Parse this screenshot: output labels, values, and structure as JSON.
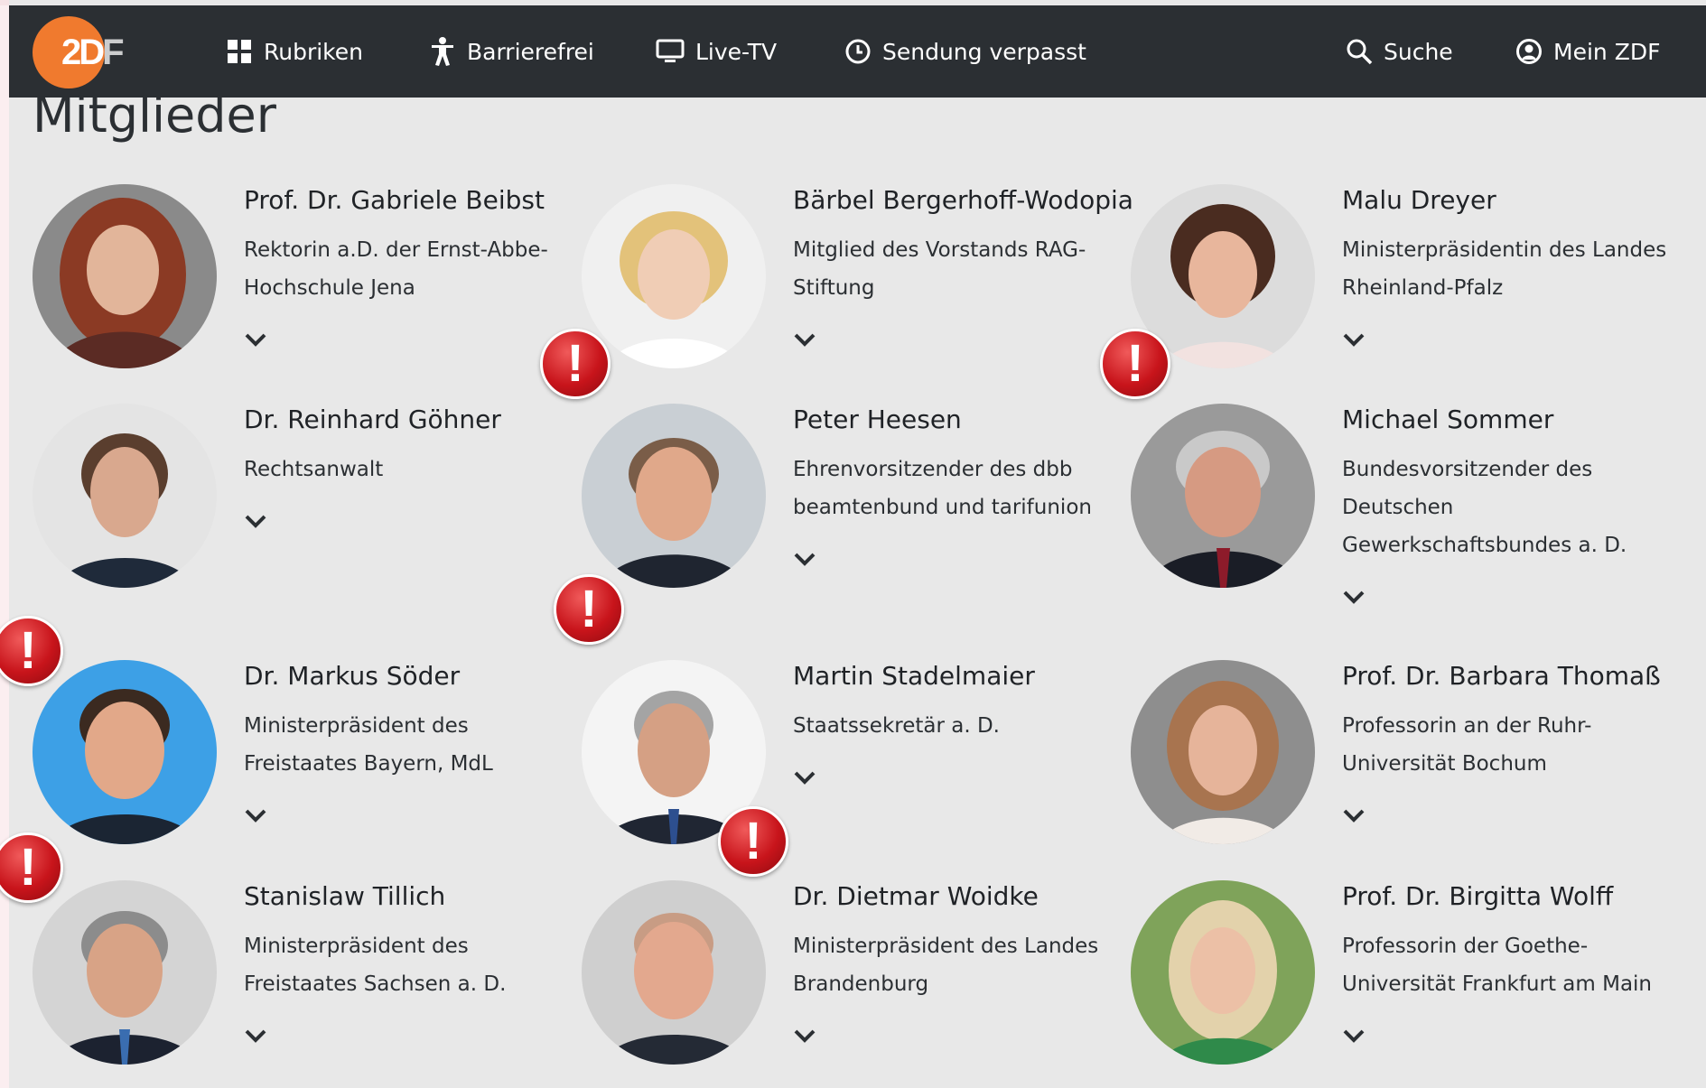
{
  "nav": {
    "logo_main": "2D",
    "logo_accent": "F",
    "items": [
      {
        "label": "Rubriken",
        "icon": "grid-icon"
      },
      {
        "label": "Barrierefrei",
        "icon": "accessibility-icon"
      },
      {
        "label": "Live-TV",
        "icon": "tv-icon"
      },
      {
        "label": "Sendung verpasst",
        "icon": "clock-icon"
      },
      {
        "label": "Suche",
        "icon": "search-icon"
      },
      {
        "label": "Mein ZDF",
        "icon": "user-icon"
      }
    ]
  },
  "section": {
    "title": "Mitglieder"
  },
  "members": [
    {
      "name": "Prof. Dr. Gabriele Beibst",
      "role": "Rektorin a.D. der Ernst-Abbe-Hochschule Jena"
    },
    {
      "name": "Bärbel Bergerhoff-Wodopia",
      "role": "Mitglied des Vorstands RAG-Stiftung"
    },
    {
      "name": "Malu Dreyer",
      "role": "Ministerpräsidentin des Landes Rheinland-Pfalz"
    },
    {
      "name": "Dr. Reinhard Göhner",
      "role": "Rechtsanwalt"
    },
    {
      "name": "Peter Heesen",
      "role": "Ehrenvorsitzender des dbb beamtenbund und tarifunion"
    },
    {
      "name": "Michael Sommer",
      "role": "Bundesvorsitzender des Deutschen Gewerkschaftsbundes a. D."
    },
    {
      "name": "Dr. Markus Söder",
      "role": "Ministerpräsident des Freistaates Bayern, MdL"
    },
    {
      "name": "Martin Stadelmaier",
      "role": "Staatssekretär a. D."
    },
    {
      "name": "Prof. Dr. Barbara Thomaß",
      "role": "Professorin an der Ruhr-Universität Bochum"
    },
    {
      "name": "Stanislaw Tillich",
      "role": "Ministerpräsident des Freistaates Sachsen a. D."
    },
    {
      "name": "Dr. Dietmar Woidke",
      "role": "Ministerpräsident des Landes Brandenburg"
    },
    {
      "name": "Prof. Dr. Birgitta Wolff",
      "role": "Professorin der Goethe-Universität Frankfurt am Main"
    }
  ],
  "alert_badge": {
    "symbol": "!",
    "color": "#c8141b"
  },
  "colors": {
    "navbar": "#2b2f33",
    "logo": "#f07a2e",
    "page_bg": "#e8e8e8"
  }
}
